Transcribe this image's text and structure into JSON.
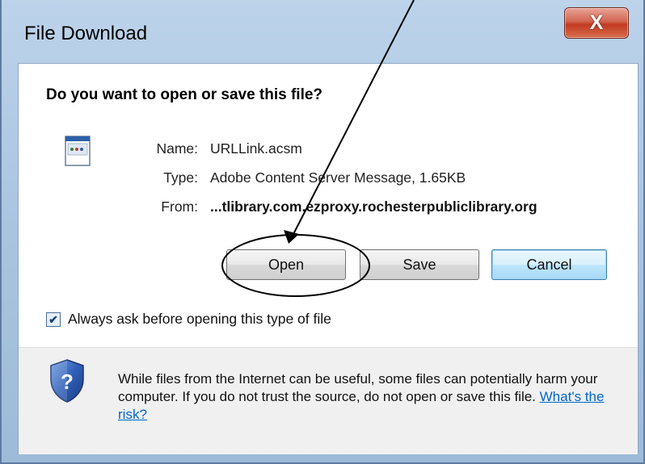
{
  "window": {
    "title": "File Download",
    "close_label": "X"
  },
  "prompt": {
    "question": "Do you want to open or save this file?"
  },
  "file": {
    "name_label": "Name:",
    "name_value": "URLLink.acsm",
    "type_label": "Type:",
    "type_value": "Adobe Content Server Message, 1.65KB",
    "from_label": "From:",
    "from_value": "...tlibrary.com.ezproxy.rochesterpubliclibrary.org"
  },
  "buttons": {
    "open": "Open",
    "save": "Save",
    "cancel": "Cancel"
  },
  "checkbox": {
    "label": "Always ask before opening this type of file",
    "checked": true
  },
  "warning": {
    "text": "While files from the Internet can be useful, some files can potentially harm your computer. If you do not trust the source, do not open or save this file.",
    "link": "What's the risk?"
  },
  "colors": {
    "link": "#0066cc",
    "close_button": "#c23a22",
    "annotation": "#000000"
  },
  "icons": [
    "file-icon",
    "shield-question-icon",
    "close-icon",
    "checkmark-icon"
  ]
}
